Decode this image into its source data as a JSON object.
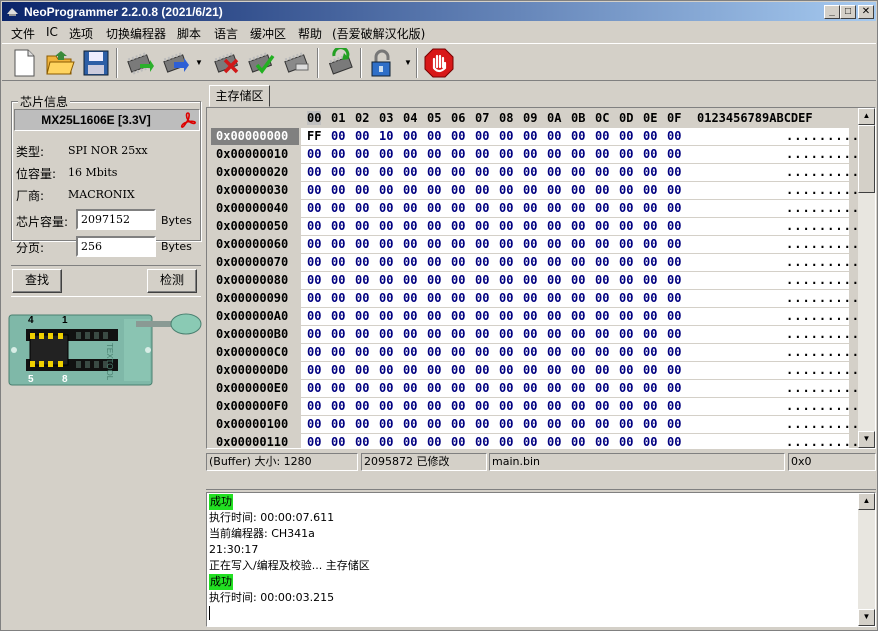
{
  "window": {
    "title": "NeoProgrammer 2.2.0.8 (2021/6/21)",
    "minimize": "_",
    "maximize": "□",
    "close": "✕"
  },
  "menu": [
    "文件",
    "IC",
    "选项",
    "切换编程器",
    "脚本",
    "语言",
    "缓冲区",
    "帮助",
    "(吾爱破解汉化版)"
  ],
  "chip": {
    "group_label": "芯片信息",
    "name": "MX25L1606E [3.3V]",
    "type_label": "类型:",
    "type_value": "SPI NOR 25xx",
    "bits_label": "位容量:",
    "bits_value": "16 Mbits",
    "vendor_label": "厂商:",
    "vendor_value": "MACRONIX",
    "size_label": "芯片容量:",
    "size_value": "2097152",
    "size_unit": "Bytes",
    "page_label": "分页:",
    "page_value": "256",
    "page_unit": "Bytes",
    "find_button": "查找",
    "detect_button": "检测",
    "socket_pin_top_left": "4",
    "socket_pin_top_right": "1",
    "socket_pin_bottom_left": "5",
    "socket_pin_bottom_right": "8",
    "socket_brand": "TEXTOOL"
  },
  "tab": {
    "label": "主存储区"
  },
  "hex": {
    "columns": [
      "00",
      "01",
      "02",
      "03",
      "04",
      "05",
      "06",
      "07",
      "08",
      "09",
      "0A",
      "0B",
      "0C",
      "0D",
      "0E",
      "0F"
    ],
    "ascii_header": "0123456789ABCDEF",
    "rows": [
      {
        "addr": "0x00000000",
        "bytes": [
          "FF",
          "00",
          "00",
          "10",
          "00",
          "00",
          "00",
          "00",
          "00",
          "00",
          "00",
          "00",
          "00",
          "00",
          "00",
          "00"
        ],
        "ascii": "................"
      },
      {
        "addr": "0x00000010",
        "bytes": [
          "00",
          "00",
          "00",
          "00",
          "00",
          "00",
          "00",
          "00",
          "00",
          "00",
          "00",
          "00",
          "00",
          "00",
          "00",
          "00"
        ],
        "ascii": "................"
      },
      {
        "addr": "0x00000020",
        "bytes": [
          "00",
          "00",
          "00",
          "00",
          "00",
          "00",
          "00",
          "00",
          "00",
          "00",
          "00",
          "00",
          "00",
          "00",
          "00",
          "00"
        ],
        "ascii": "................"
      },
      {
        "addr": "0x00000030",
        "bytes": [
          "00",
          "00",
          "00",
          "00",
          "00",
          "00",
          "00",
          "00",
          "00",
          "00",
          "00",
          "00",
          "00",
          "00",
          "00",
          "00"
        ],
        "ascii": "................"
      },
      {
        "addr": "0x00000040",
        "bytes": [
          "00",
          "00",
          "00",
          "00",
          "00",
          "00",
          "00",
          "00",
          "00",
          "00",
          "00",
          "00",
          "00",
          "00",
          "00",
          "00"
        ],
        "ascii": "................"
      },
      {
        "addr": "0x00000050",
        "bytes": [
          "00",
          "00",
          "00",
          "00",
          "00",
          "00",
          "00",
          "00",
          "00",
          "00",
          "00",
          "00",
          "00",
          "00",
          "00",
          "00"
        ],
        "ascii": "................"
      },
      {
        "addr": "0x00000060",
        "bytes": [
          "00",
          "00",
          "00",
          "00",
          "00",
          "00",
          "00",
          "00",
          "00",
          "00",
          "00",
          "00",
          "00",
          "00",
          "00",
          "00"
        ],
        "ascii": "................"
      },
      {
        "addr": "0x00000070",
        "bytes": [
          "00",
          "00",
          "00",
          "00",
          "00",
          "00",
          "00",
          "00",
          "00",
          "00",
          "00",
          "00",
          "00",
          "00",
          "00",
          "00"
        ],
        "ascii": "................"
      },
      {
        "addr": "0x00000080",
        "bytes": [
          "00",
          "00",
          "00",
          "00",
          "00",
          "00",
          "00",
          "00",
          "00",
          "00",
          "00",
          "00",
          "00",
          "00",
          "00",
          "00"
        ],
        "ascii": "................"
      },
      {
        "addr": "0x00000090",
        "bytes": [
          "00",
          "00",
          "00",
          "00",
          "00",
          "00",
          "00",
          "00",
          "00",
          "00",
          "00",
          "00",
          "00",
          "00",
          "00",
          "00"
        ],
        "ascii": "................"
      },
      {
        "addr": "0x000000A0",
        "bytes": [
          "00",
          "00",
          "00",
          "00",
          "00",
          "00",
          "00",
          "00",
          "00",
          "00",
          "00",
          "00",
          "00",
          "00",
          "00",
          "00"
        ],
        "ascii": "................"
      },
      {
        "addr": "0x000000B0",
        "bytes": [
          "00",
          "00",
          "00",
          "00",
          "00",
          "00",
          "00",
          "00",
          "00",
          "00",
          "00",
          "00",
          "00",
          "00",
          "00",
          "00"
        ],
        "ascii": "................"
      },
      {
        "addr": "0x000000C0",
        "bytes": [
          "00",
          "00",
          "00",
          "00",
          "00",
          "00",
          "00",
          "00",
          "00",
          "00",
          "00",
          "00",
          "00",
          "00",
          "00",
          "00"
        ],
        "ascii": "................"
      },
      {
        "addr": "0x000000D0",
        "bytes": [
          "00",
          "00",
          "00",
          "00",
          "00",
          "00",
          "00",
          "00",
          "00",
          "00",
          "00",
          "00",
          "00",
          "00",
          "00",
          "00"
        ],
        "ascii": "................"
      },
      {
        "addr": "0x000000E0",
        "bytes": [
          "00",
          "00",
          "00",
          "00",
          "00",
          "00",
          "00",
          "00",
          "00",
          "00",
          "00",
          "00",
          "00",
          "00",
          "00",
          "00"
        ],
        "ascii": "................"
      },
      {
        "addr": "0x000000F0",
        "bytes": [
          "00",
          "00",
          "00",
          "00",
          "00",
          "00",
          "00",
          "00",
          "00",
          "00",
          "00",
          "00",
          "00",
          "00",
          "00",
          "00"
        ],
        "ascii": "................"
      },
      {
        "addr": "0x00000100",
        "bytes": [
          "00",
          "00",
          "00",
          "00",
          "00",
          "00",
          "00",
          "00",
          "00",
          "00",
          "00",
          "00",
          "00",
          "00",
          "00",
          "00"
        ],
        "ascii": "................"
      },
      {
        "addr": "0x00000110",
        "bytes": [
          "00",
          "00",
          "00",
          "00",
          "00",
          "00",
          "00",
          "00",
          "00",
          "00",
          "00",
          "00",
          "00",
          "00",
          "00",
          "00"
        ],
        "ascii": "................"
      }
    ]
  },
  "status": {
    "buffer": "(Buffer) 大小:  1280",
    "modified": "2095872 已修改",
    "file": "main.bin",
    "empty": "",
    "offset": "0x0"
  },
  "log": [
    {
      "text": "成功",
      "ok": true
    },
    {
      "text": "执行时间:  00:00:07.611",
      "ok": false
    },
    {
      "text": "当前编程器: CH341a",
      "ok": false
    },
    {
      "text": "21:30:17",
      "ok": false
    },
    {
      "text": "正在写入/编程及校验... 主存储区",
      "ok": false
    },
    {
      "text": "成功",
      "ok": true
    },
    {
      "text": "执行时间:  00:00:03.215",
      "ok": false
    }
  ],
  "colors": {
    "hex_text": "#000080",
    "log_ok_bg": "#22e022",
    "titlebar": "#0a246a"
  }
}
